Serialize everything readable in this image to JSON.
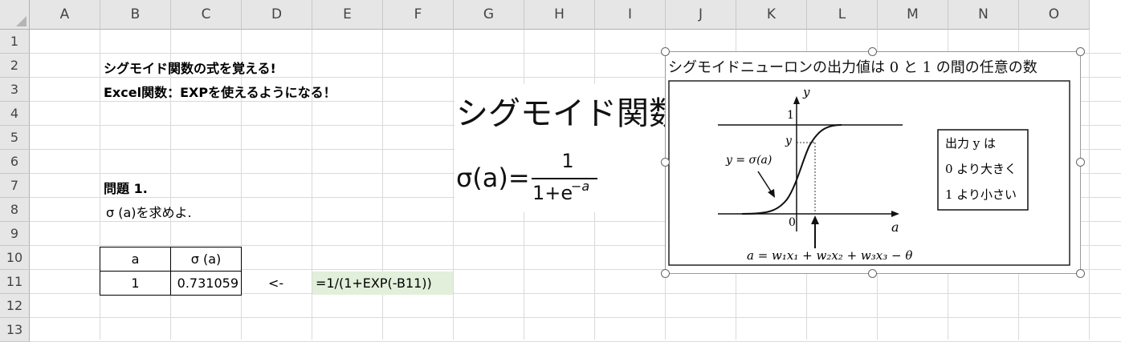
{
  "columns": [
    "A",
    "B",
    "C",
    "D",
    "E",
    "F",
    "G",
    "H",
    "I",
    "J",
    "K",
    "L",
    "M",
    "N",
    "O"
  ],
  "rows": [
    "1",
    "2",
    "3",
    "4",
    "5",
    "6",
    "7",
    "8",
    "9",
    "10",
    "11",
    "12",
    "13"
  ],
  "cells": {
    "b2": "シグモイド関数の式を覚える!",
    "b3": "Excel関数：EXPを使えるようになる！",
    "b7": "問題 1.",
    "b8": "σ (a)を求めよ.",
    "b10": "a",
    "c10": "σ (a)",
    "b11": "1",
    "c11": "0.731059",
    "d11": "<-",
    "e11": "=1/(1+EXP(-B11))"
  },
  "formula_image": {
    "title": "シグモイド関数",
    "lhs": "σ(a)=",
    "numerator": "1",
    "denominator": "1+e",
    "exponent": "−a"
  },
  "figure": {
    "caption": "シグモイドニューロンの出力値は 0 と 1 の間の任意の数",
    "y_axis": "y",
    "x_axis": "a",
    "tick_one": "1",
    "tick_y": "y",
    "origin": "0",
    "curve_label": "y = σ(a)",
    "legend_line1": "出力 y は",
    "legend_line2": "0 より大きく",
    "legend_line3": "1 より小さい",
    "bottom_eq": "a = w₁x₁ + w₂x₂ + w₃x₃ − θ"
  },
  "colors": {
    "header_bg": "#e6e6e6",
    "grid_line": "#dadada",
    "formula_cell_bg": "#e2efda"
  }
}
